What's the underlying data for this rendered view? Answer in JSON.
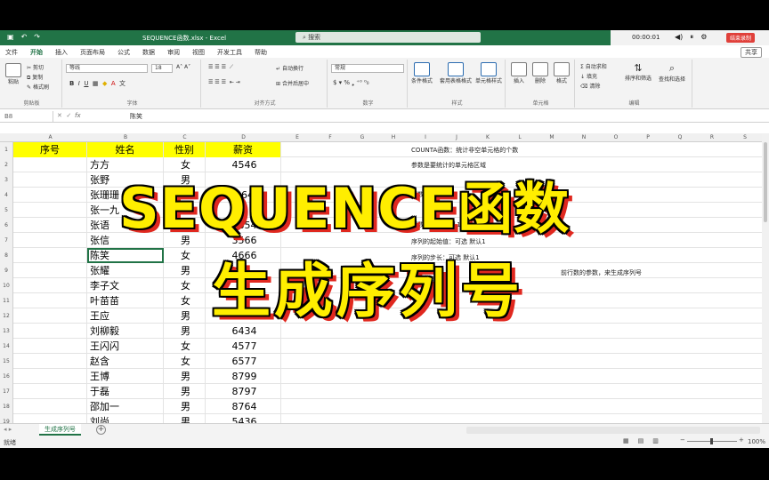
{
  "titlebar": {
    "qa_icons": [
      "save-icon",
      "undo-icon",
      "redo-icon"
    ],
    "doc_title": "SEQUENCE函数.xlsx  -  Excel",
    "search_placeholder": "搜索",
    "timer": "00:00:01",
    "end_button": "结束录制"
  },
  "menu": {
    "tabs": [
      "文件",
      "开始",
      "插入",
      "页面布局",
      "公式",
      "数据",
      "审阅",
      "视图",
      "开发工具",
      "帮助"
    ],
    "active": "开始",
    "share": "共享"
  },
  "ribbon": {
    "clipboard": {
      "paste": "粘贴",
      "cut": "剪切",
      "copy": "复制",
      "format_painter": "格式刷",
      "label": "剪贴板"
    },
    "font": {
      "name": "等线",
      "size": "18",
      "label": "字体"
    },
    "alignment": {
      "wrap": "自动换行",
      "merge": "合并后居中",
      "label": "对齐方式"
    },
    "number": {
      "format": "常规",
      "label": "数字"
    },
    "styles": {
      "conditional": "条件格式",
      "table": "套用表格格式",
      "cell": "单元格样式",
      "label": "样式"
    },
    "cells": {
      "insert": "插入",
      "delete": "删除",
      "format": "格式",
      "label": "单元格"
    },
    "editing": {
      "autosum": "自动求和",
      "fill": "填充",
      "clear": "清除",
      "sort": "排序和筛选",
      "find": "查找和选择",
      "label": "编辑"
    }
  },
  "formula_bar": {
    "name_box": "B8",
    "fx": "fx",
    "value": "陈笑"
  },
  "columns": [
    "A",
    "B",
    "C",
    "D",
    "E",
    "F",
    "G",
    "H",
    "I",
    "J",
    "K",
    "L",
    "M",
    "N",
    "O",
    "P",
    "Q",
    "R",
    "S"
  ],
  "table": {
    "headers": [
      "序号",
      "姓名",
      "性别",
      "薪资"
    ],
    "rows": [
      [
        "",
        "方方",
        "女",
        "4546"
      ],
      [
        "",
        "张野",
        "男",
        ""
      ],
      [
        "",
        "张珊珊",
        "",
        "464"
      ],
      [
        "",
        "张一九",
        "",
        ""
      ],
      [
        "",
        "张语",
        "女",
        "7854"
      ],
      [
        "",
        "张信",
        "男",
        "3566"
      ],
      [
        "",
        "陈笑",
        "女",
        "4666"
      ],
      [
        "",
        "张耀",
        "男",
        ""
      ],
      [
        "",
        "李子文",
        "女",
        ""
      ],
      [
        "",
        "叶苗苗",
        "女",
        ""
      ],
      [
        "",
        "王应",
        "男",
        ""
      ],
      [
        "",
        "刘柳毅",
        "男",
        "6434"
      ],
      [
        "",
        "王闪闪",
        "女",
        "4577"
      ],
      [
        "",
        "赵含",
        "女",
        "6577"
      ],
      [
        "",
        "王博",
        "男",
        "8799"
      ],
      [
        "",
        "于磊",
        "男",
        "8797"
      ],
      [
        "",
        "邵加一",
        "男",
        "8764"
      ],
      [
        "",
        "刘尚",
        "男",
        "5436"
      ]
    ]
  },
  "notes": [
    "COUNTA函数：统计非空单元格的个数",
    "参数是要统计的单元格区域",
    "行数：行数",
    "列数：可选 默认1",
    "序列的起始值：可选 默认1",
    "序列的步长：可选 默认1",
    "前行数的参数，来生成序列号"
  ],
  "overlay": {
    "line1": "SEQUENCE函数",
    "line2": "生成序列号"
  },
  "sheet_tab": "生成序列号",
  "status": {
    "ready": "就绪",
    "zoom": "100%"
  }
}
